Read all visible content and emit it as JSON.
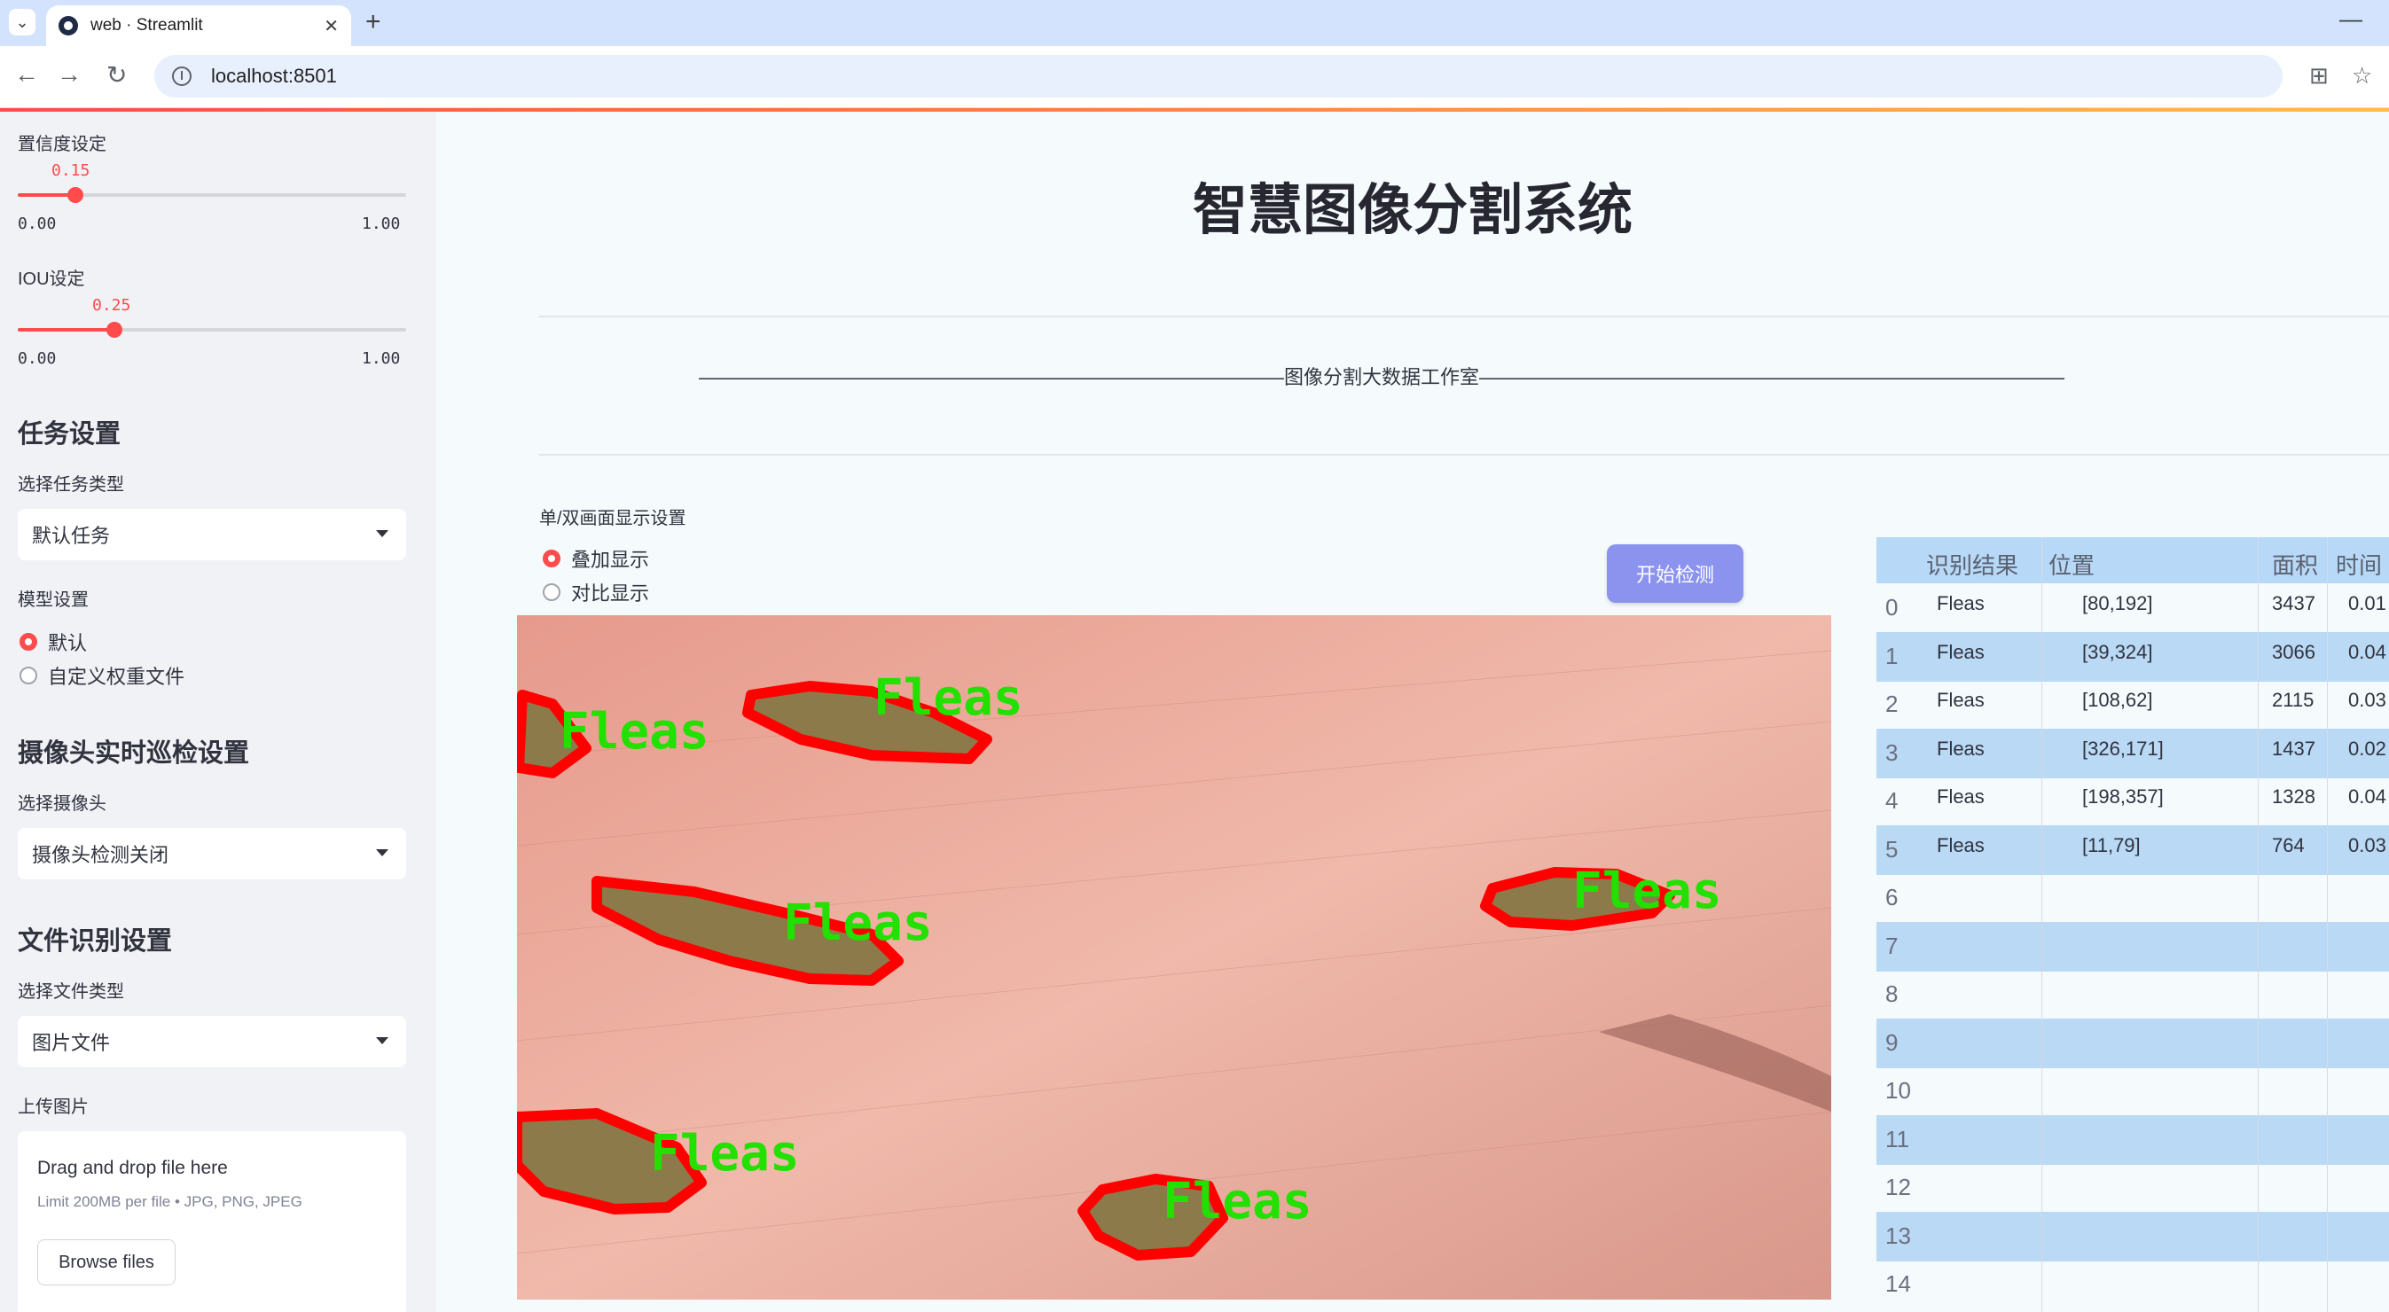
{
  "browser": {
    "tab_title": "web · Streamlit",
    "url": "localhost:8501"
  },
  "sidebar": {
    "confidence": {
      "label": "置信度设定",
      "value": "0.15",
      "value_num": 0.15,
      "min": "0.00",
      "max": "1.00"
    },
    "iou": {
      "label": "IOU设定",
      "value": "0.25",
      "value_num": 0.25,
      "min": "0.00",
      "max": "1.00"
    },
    "task_heading": "任务设置",
    "task_type_label": "选择任务类型",
    "task_type_value": "默认任务",
    "model_label": "模型设置",
    "model_options": [
      "默认",
      "自定义权重文件"
    ],
    "model_selected": "默认",
    "camera_heading": "摄像头实时巡检设置",
    "camera_label": "选择摄像头",
    "camera_value": "摄像头检测关闭",
    "file_heading": "文件识别设置",
    "file_type_label": "选择文件类型",
    "file_type_value": "图片文件",
    "upload_label": "上传图片",
    "uploader": {
      "drop_text": "Drag and drop file here",
      "limit_text": "Limit 200MB per file • JPG, PNG, JPEG",
      "browse_label": "Browse files"
    }
  },
  "main": {
    "title": "智慧图像分割系统",
    "studio_line": "——————————————————————————————图像分割大数据工作室——————————————————————————————",
    "display_mode_label": "单/双画面显示设置",
    "display_options": [
      "叠加显示",
      "对比显示"
    ],
    "display_selected": "叠加显示",
    "start_button": "开始检测",
    "detection_label": "Fleas"
  },
  "table": {
    "columns": [
      "识别结果",
      "位置",
      "面积",
      "时间"
    ],
    "rows": [
      {
        "idx": "0",
        "result": "Fleas",
        "position": "[80,192]",
        "area": "3437",
        "time": "0.01"
      },
      {
        "idx": "1",
        "result": "Fleas",
        "position": "[39,324]",
        "area": "3066",
        "time": "0.04"
      },
      {
        "idx": "2",
        "result": "Fleas",
        "position": "[108,62]",
        "area": "2115",
        "time": "0.03"
      },
      {
        "idx": "3",
        "result": "Fleas",
        "position": "[326,171]",
        "area": "1437",
        "time": "0.02"
      },
      {
        "idx": "4",
        "result": "Fleas",
        "position": "[198,357]",
        "area": "1328",
        "time": "0.04"
      },
      {
        "idx": "5",
        "result": "Fleas",
        "position": "[11,79]",
        "area": "764",
        "time": "0.03"
      },
      {
        "idx": "6",
        "result": "",
        "position": "",
        "area": "",
        "time": ""
      },
      {
        "idx": "7",
        "result": "",
        "position": "",
        "area": "",
        "time": ""
      },
      {
        "idx": "8",
        "result": "",
        "position": "",
        "area": "",
        "time": ""
      },
      {
        "idx": "9",
        "result": "",
        "position": "",
        "area": "",
        "time": ""
      },
      {
        "idx": "10",
        "result": "",
        "position": "",
        "area": "",
        "time": ""
      },
      {
        "idx": "11",
        "result": "",
        "position": "",
        "area": "",
        "time": ""
      },
      {
        "idx": "12",
        "result": "",
        "position": "",
        "area": "",
        "time": ""
      },
      {
        "idx": "13",
        "result": "",
        "position": "",
        "area": "",
        "time": ""
      },
      {
        "idx": "14",
        "result": "",
        "position": "",
        "area": "",
        "time": ""
      }
    ]
  },
  "colors": {
    "accent": "#ff4b4b",
    "button": "#8b93ee",
    "mask_outline": "#ff0000",
    "label_green": "#22e000"
  }
}
